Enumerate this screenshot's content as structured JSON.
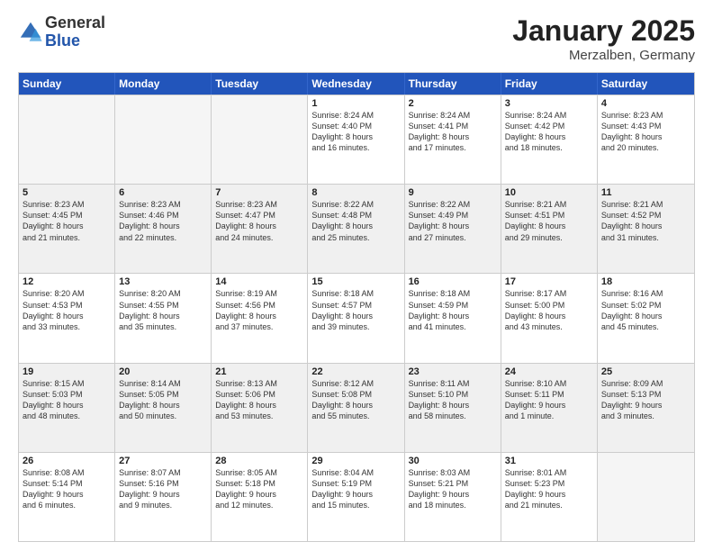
{
  "logo": {
    "general": "General",
    "blue": "Blue"
  },
  "title": {
    "month": "January 2025",
    "location": "Merzalben, Germany"
  },
  "headers": [
    "Sunday",
    "Monday",
    "Tuesday",
    "Wednesday",
    "Thursday",
    "Friday",
    "Saturday"
  ],
  "rows": [
    [
      {
        "day": "",
        "info": "",
        "empty": true
      },
      {
        "day": "",
        "info": "",
        "empty": true
      },
      {
        "day": "",
        "info": "",
        "empty": true
      },
      {
        "day": "1",
        "info": "Sunrise: 8:24 AM\nSunset: 4:40 PM\nDaylight: 8 hours\nand 16 minutes."
      },
      {
        "day": "2",
        "info": "Sunrise: 8:24 AM\nSunset: 4:41 PM\nDaylight: 8 hours\nand 17 minutes."
      },
      {
        "day": "3",
        "info": "Sunrise: 8:24 AM\nSunset: 4:42 PM\nDaylight: 8 hours\nand 18 minutes."
      },
      {
        "day": "4",
        "info": "Sunrise: 8:23 AM\nSunset: 4:43 PM\nDaylight: 8 hours\nand 20 minutes."
      }
    ],
    [
      {
        "day": "5",
        "info": "Sunrise: 8:23 AM\nSunset: 4:45 PM\nDaylight: 8 hours\nand 21 minutes.",
        "shaded": true
      },
      {
        "day": "6",
        "info": "Sunrise: 8:23 AM\nSunset: 4:46 PM\nDaylight: 8 hours\nand 22 minutes.",
        "shaded": true
      },
      {
        "day": "7",
        "info": "Sunrise: 8:23 AM\nSunset: 4:47 PM\nDaylight: 8 hours\nand 24 minutes.",
        "shaded": true
      },
      {
        "day": "8",
        "info": "Sunrise: 8:22 AM\nSunset: 4:48 PM\nDaylight: 8 hours\nand 25 minutes.",
        "shaded": true
      },
      {
        "day": "9",
        "info": "Sunrise: 8:22 AM\nSunset: 4:49 PM\nDaylight: 8 hours\nand 27 minutes.",
        "shaded": true
      },
      {
        "day": "10",
        "info": "Sunrise: 8:21 AM\nSunset: 4:51 PM\nDaylight: 8 hours\nand 29 minutes.",
        "shaded": true
      },
      {
        "day": "11",
        "info": "Sunrise: 8:21 AM\nSunset: 4:52 PM\nDaylight: 8 hours\nand 31 minutes.",
        "shaded": true
      }
    ],
    [
      {
        "day": "12",
        "info": "Sunrise: 8:20 AM\nSunset: 4:53 PM\nDaylight: 8 hours\nand 33 minutes."
      },
      {
        "day": "13",
        "info": "Sunrise: 8:20 AM\nSunset: 4:55 PM\nDaylight: 8 hours\nand 35 minutes."
      },
      {
        "day": "14",
        "info": "Sunrise: 8:19 AM\nSunset: 4:56 PM\nDaylight: 8 hours\nand 37 minutes."
      },
      {
        "day": "15",
        "info": "Sunrise: 8:18 AM\nSunset: 4:57 PM\nDaylight: 8 hours\nand 39 minutes."
      },
      {
        "day": "16",
        "info": "Sunrise: 8:18 AM\nSunset: 4:59 PM\nDaylight: 8 hours\nand 41 minutes."
      },
      {
        "day": "17",
        "info": "Sunrise: 8:17 AM\nSunset: 5:00 PM\nDaylight: 8 hours\nand 43 minutes."
      },
      {
        "day": "18",
        "info": "Sunrise: 8:16 AM\nSunset: 5:02 PM\nDaylight: 8 hours\nand 45 minutes."
      }
    ],
    [
      {
        "day": "19",
        "info": "Sunrise: 8:15 AM\nSunset: 5:03 PM\nDaylight: 8 hours\nand 48 minutes.",
        "shaded": true
      },
      {
        "day": "20",
        "info": "Sunrise: 8:14 AM\nSunset: 5:05 PM\nDaylight: 8 hours\nand 50 minutes.",
        "shaded": true
      },
      {
        "day": "21",
        "info": "Sunrise: 8:13 AM\nSunset: 5:06 PM\nDaylight: 8 hours\nand 53 minutes.",
        "shaded": true
      },
      {
        "day": "22",
        "info": "Sunrise: 8:12 AM\nSunset: 5:08 PM\nDaylight: 8 hours\nand 55 minutes.",
        "shaded": true
      },
      {
        "day": "23",
        "info": "Sunrise: 8:11 AM\nSunset: 5:10 PM\nDaylight: 8 hours\nand 58 minutes.",
        "shaded": true
      },
      {
        "day": "24",
        "info": "Sunrise: 8:10 AM\nSunset: 5:11 PM\nDaylight: 9 hours\nand 1 minute.",
        "shaded": true
      },
      {
        "day": "25",
        "info": "Sunrise: 8:09 AM\nSunset: 5:13 PM\nDaylight: 9 hours\nand 3 minutes.",
        "shaded": true
      }
    ],
    [
      {
        "day": "26",
        "info": "Sunrise: 8:08 AM\nSunset: 5:14 PM\nDaylight: 9 hours\nand 6 minutes."
      },
      {
        "day": "27",
        "info": "Sunrise: 8:07 AM\nSunset: 5:16 PM\nDaylight: 9 hours\nand 9 minutes."
      },
      {
        "day": "28",
        "info": "Sunrise: 8:05 AM\nSunset: 5:18 PM\nDaylight: 9 hours\nand 12 minutes."
      },
      {
        "day": "29",
        "info": "Sunrise: 8:04 AM\nSunset: 5:19 PM\nDaylight: 9 hours\nand 15 minutes."
      },
      {
        "day": "30",
        "info": "Sunrise: 8:03 AM\nSunset: 5:21 PM\nDaylight: 9 hours\nand 18 minutes."
      },
      {
        "day": "31",
        "info": "Sunrise: 8:01 AM\nSunset: 5:23 PM\nDaylight: 9 hours\nand 21 minutes."
      },
      {
        "day": "",
        "info": "",
        "empty": true
      }
    ]
  ]
}
